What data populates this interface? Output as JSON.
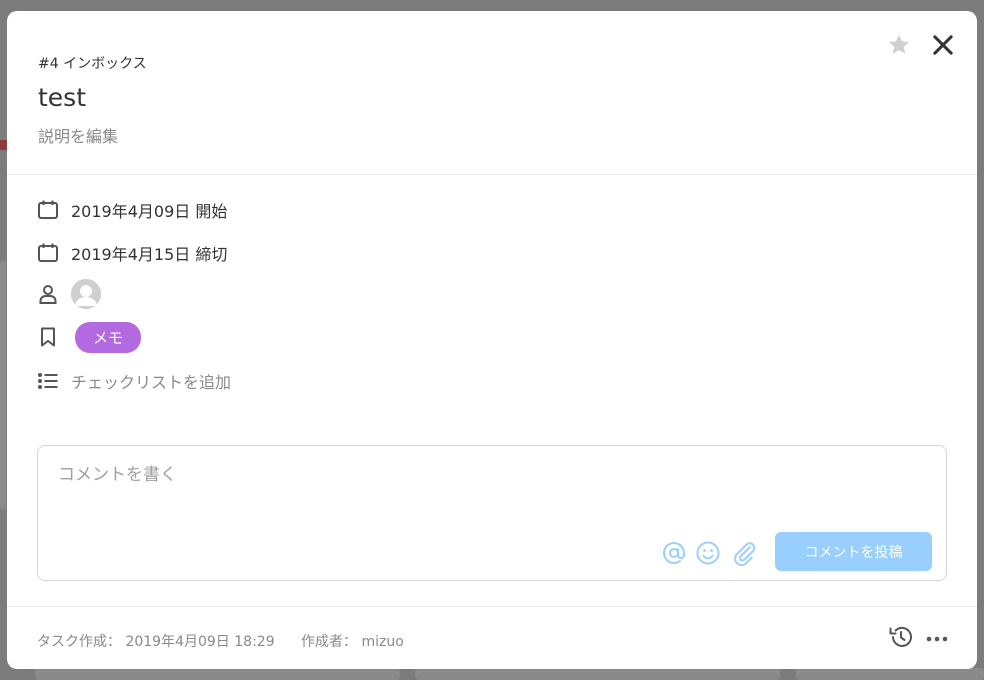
{
  "task": {
    "breadcrumb": "#4 インボックス",
    "title": "test",
    "edit_description": "説明を編集"
  },
  "icons": {
    "star": "star-icon",
    "close": "close-icon",
    "calendar": "calendar-icon",
    "person": "person-icon",
    "bookmark": "bookmark-icon",
    "checklist": "checklist-icon",
    "mention": "at-icon",
    "emoji": "smile-icon",
    "attach": "paperclip-icon",
    "history": "history-icon",
    "more": "more-icon"
  },
  "details": {
    "start_date": "2019年4月09日 開始",
    "due_date": "2019年4月15日 締切",
    "tag": "メモ",
    "add_checklist": "チェックリストを追加"
  },
  "comment": {
    "placeholder": "コメントを書く",
    "post_label": "コメントを投稿"
  },
  "footer": {
    "created": "タスク作成： 2019年4月09日 18:29",
    "author": "作成者： mizuo"
  },
  "colors": {
    "tag": "#b36ae0",
    "post_button": "#99cfff",
    "mention_icons": "#9ccfff"
  }
}
